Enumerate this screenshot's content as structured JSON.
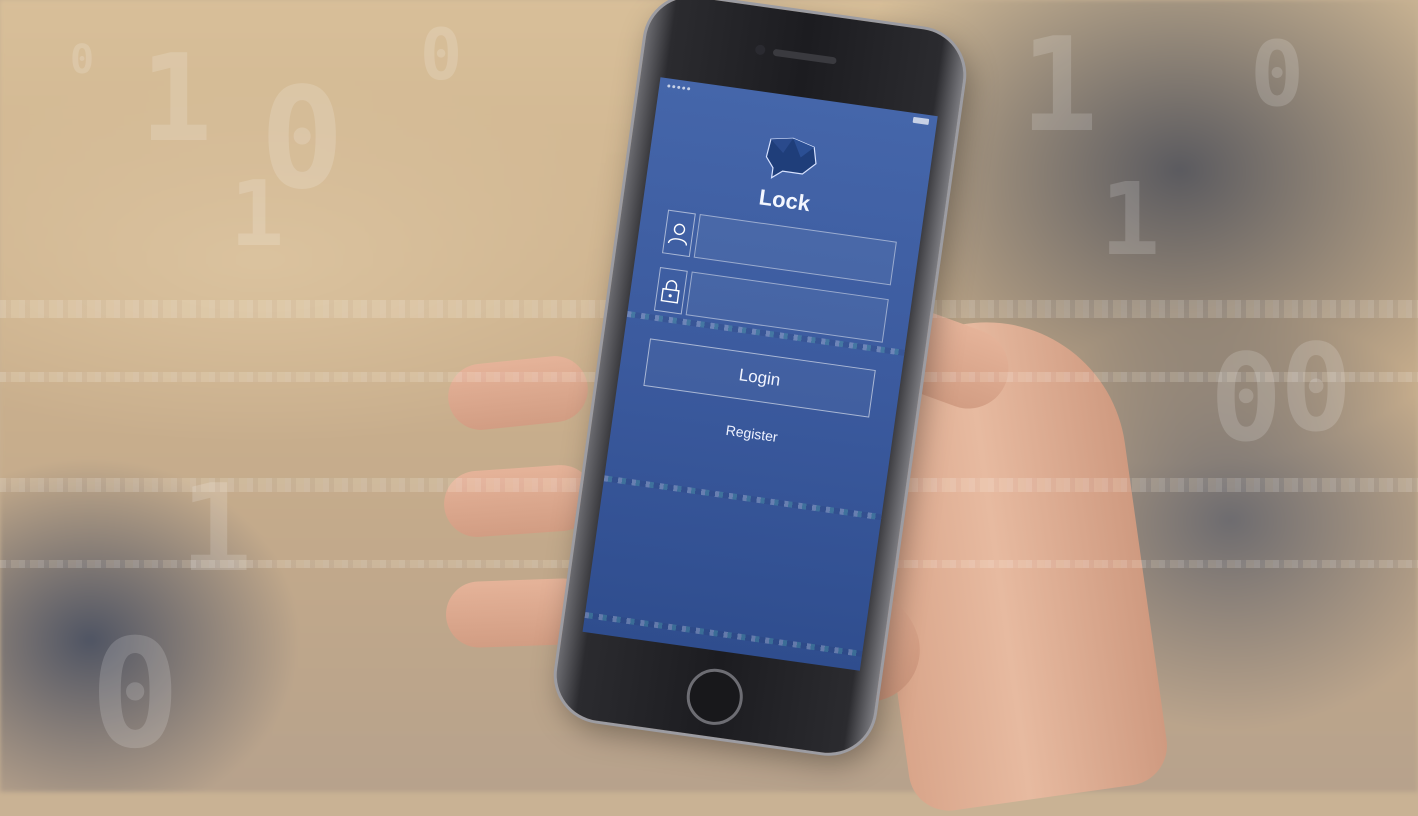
{
  "app": {
    "name": "Lock",
    "logo_icon": "speech-bubble-icon"
  },
  "form": {
    "username_icon": "user-icon",
    "password_icon": "padlock-icon",
    "username_value": "",
    "password_value": "",
    "login_label": "Login",
    "register_label": "Register"
  },
  "colors": {
    "screen_blue": "#3b5a9e",
    "text_light": "#f4f7ff",
    "field_border": "#ffffff"
  }
}
